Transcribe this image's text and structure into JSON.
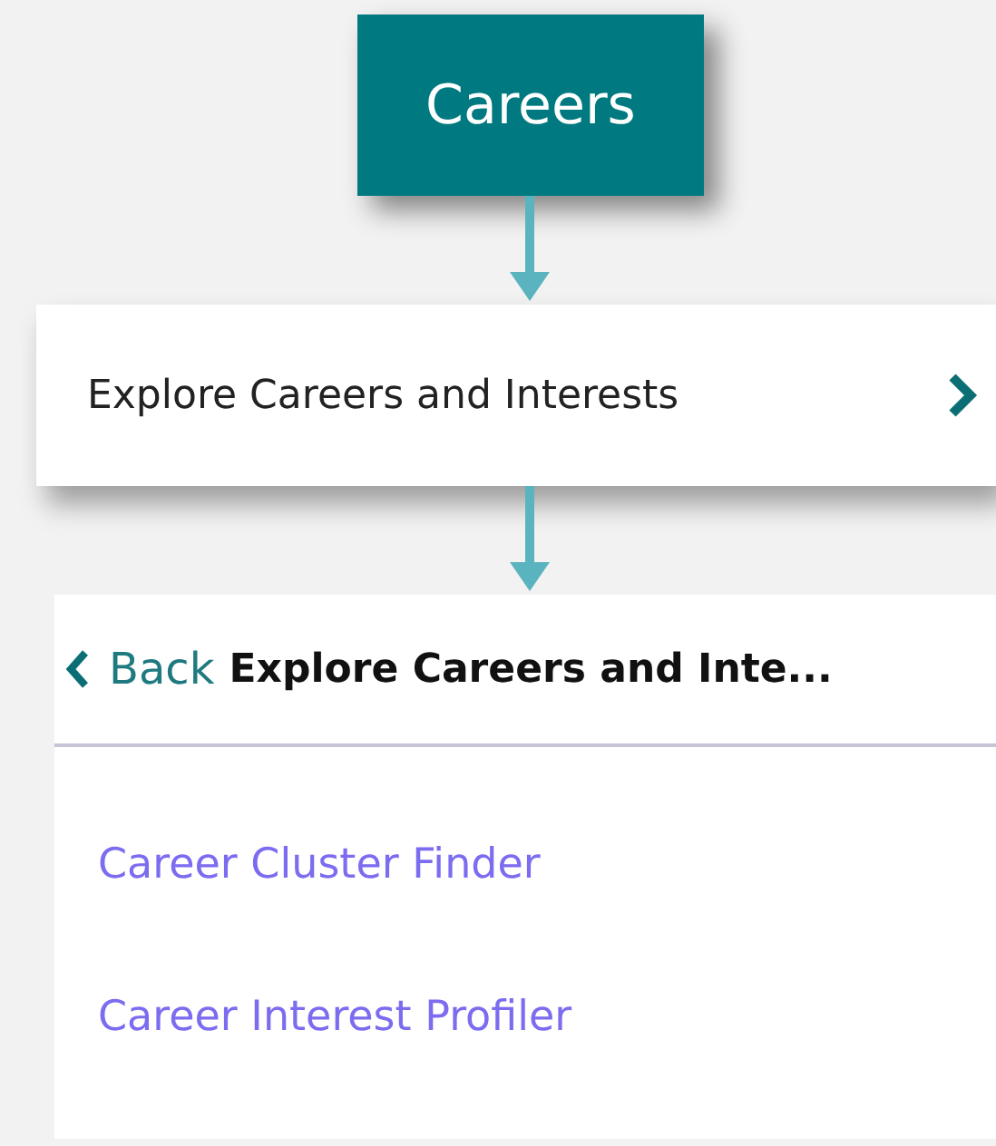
{
  "top_button": {
    "label": "Careers"
  },
  "menu_item": {
    "label": "Explore Careers and Interests"
  },
  "panel": {
    "back_label": "Back",
    "title": "Explore Careers and Inte...",
    "links": [
      {
        "label": "Career Cluster Finder"
      },
      {
        "label": "Career Interest Profiler"
      }
    ]
  }
}
